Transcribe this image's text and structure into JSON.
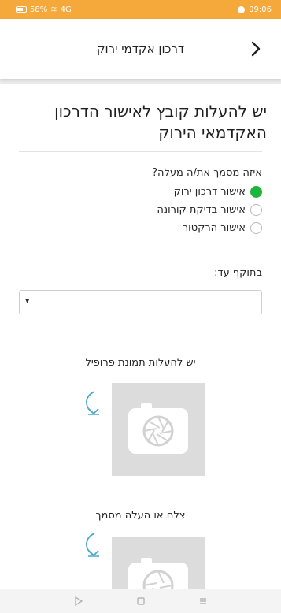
{
  "status_bar": {
    "left_text": "58%",
    "network_text": "4G",
    "time": "09:06"
  },
  "app_bar": {
    "title": "דרכון אקדמי ירוק",
    "back_icon": "chevron-right-icon"
  },
  "page": {
    "title": "יש להעלות קובץ לאישור הדרכון האקדמאי הירוק",
    "question": "איזה מסמך את/ה מעלה?",
    "options": [
      {
        "label": "אישור דרכון ירוק",
        "selected": true
      },
      {
        "label": "אישור בדיקת קורונה",
        "selected": false
      },
      {
        "label": "אישור הרקטור",
        "selected": false
      }
    ],
    "valid_until_label": "בתוקף עד:",
    "date_select_value": "",
    "profile_upload_label": "יש להעלות תמונת פרופיל",
    "document_upload_label": "צלם או העלה מסמך"
  },
  "colors": {
    "status_bar": "#f6a93b",
    "radio_selected": "#1db53a",
    "upload_box": "#dcdcdc",
    "rotate_icon": "#4aa8c8"
  }
}
